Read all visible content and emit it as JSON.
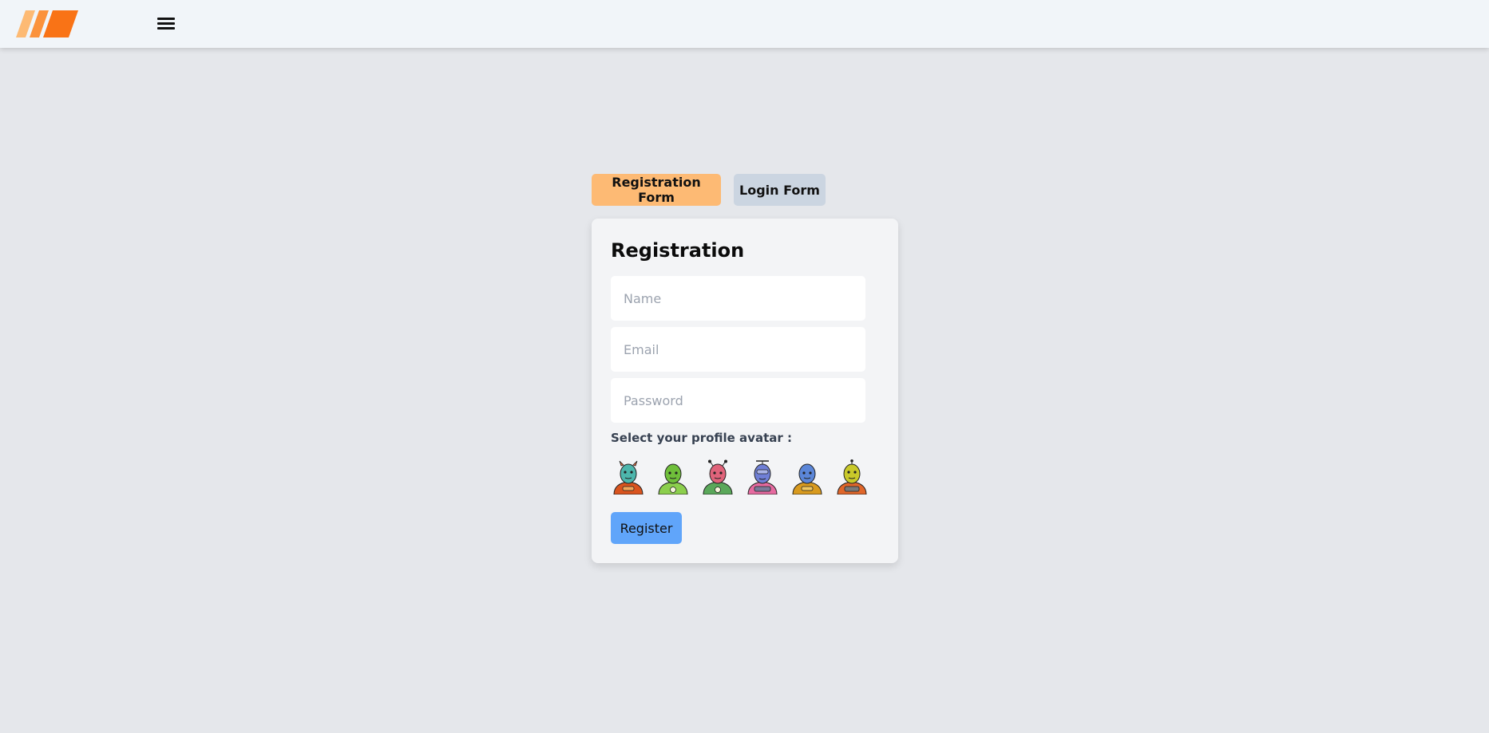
{
  "header": {
    "logo_icon": "striped-logo-icon",
    "menu_icon": "hamburger-menu-icon",
    "logo_colors": [
      "#fdba74",
      "#fb923c",
      "#f97316"
    ]
  },
  "tabs": {
    "registration_label": "Registration Form",
    "login_label": "Login Form",
    "active": "registration"
  },
  "form": {
    "title": "Registration",
    "name_placeholder": "Name",
    "email_placeholder": "Email",
    "password_placeholder": "Password",
    "name_value": "",
    "email_value": "",
    "password_value": "",
    "avatar_label": "Select your profile avatar :",
    "avatars": [
      {
        "icon": "teal-horned-avatar-icon",
        "skin": "#4db6ac",
        "outfit": "#d9541e"
      },
      {
        "icon": "green-bald-avatar-icon",
        "skin": "#7cc243",
        "outfit": "#6fbf3a"
      },
      {
        "icon": "pink-antenna-avatar-icon",
        "skin": "#e0637a",
        "outfit": "#5aa85a"
      },
      {
        "icon": "blue-propeller-avatar-icon",
        "skin": "#6f7fd6",
        "outfit": "#e66aa0"
      },
      {
        "icon": "blue-bald-avatar-icon",
        "skin": "#5b86d8",
        "outfit": "#d89a1e"
      },
      {
        "icon": "yellow-antenna-avatar-icon",
        "skin": "#c9c92a",
        "outfit": "#e0662a"
      }
    ],
    "submit_label": "Register"
  },
  "colors": {
    "page_bg": "#e5e7eb",
    "header_bg": "#f1f5f9",
    "active_tab": "#fdba74",
    "inactive_tab": "#cbd5e1",
    "submit": "#60a5fa"
  }
}
